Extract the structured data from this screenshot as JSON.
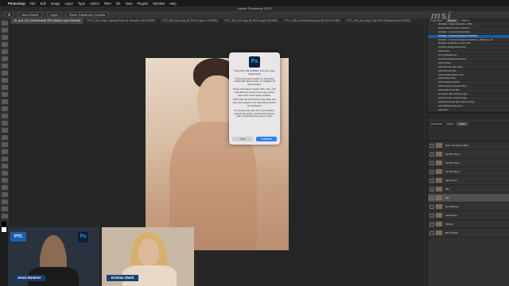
{
  "menubar": {
    "items": [
      "Photoshop",
      "File",
      "Edit",
      "Image",
      "Layer",
      "Type",
      "Select",
      "Filter",
      "3D",
      "View",
      "Plugins",
      "Window",
      "Help"
    ],
    "right": ""
  },
  "app_title": "Adobe Photoshop 2023",
  "options": {
    "auto_select": "Auto-Select:",
    "layer": "Layer",
    "transform": "Show Transform Controls"
  },
  "tabs": [
    {
      "label": "JS_and_KS_Reference@ 25% (Black Layer Mask/8)",
      "active": true
    },
    {
      "label": "PTC_DB_Pose_Spring Prom 04 Sample 108 RGB/8*",
      "active": false
    },
    {
      "label": "PTC_DB_full-copy @ 25% (Layer 4 RGB/8)",
      "active": false
    },
    {
      "label": "PTC_DB_full copy @ 25% (Layer RGB/8)",
      "active": false
    },
    {
      "label": "PTC_DB_in-sharpening.psd @ 25% RGB/8",
      "active": false
    },
    {
      "label": "PTC_DB_full copy 2 @ 25% (Background RGB/8)",
      "active": false
    }
  ],
  "dialog": {
    "logo": "Ps",
    "paragraphs": [
      "The action has finished, here are a few helpful hints",
      "You'll only need to paint on the group masks (the black ones), so collapse all layer groups.",
      "Press Command / Option (PC: Ctrl + Alt) and click any arrow next to any group layer icon in the layers window.",
      "Paint with the brush tool using white at a very low opacity in the retouching doesn't go overboard.",
      "To remove this note from your actions, expand the action, scroll to the bottom, and uncheck the box next to Stop."
    ],
    "stop_label": "Stop",
    "continue_label": "Continue"
  },
  "watermark": "msi",
  "panels": {
    "top_tabs": [
      "Properties",
      "Actions",
      "History"
    ],
    "action_rows": [
      {
        "label": "Workflow - Image preparation_MSM",
        "sel": false
      },
      {
        "label": "Instant Glow Fix Action Collection",
        "sel": false
      },
      {
        "label": "Workflow - Frequency Separation",
        "sel": false
      },
      {
        "label": "Workflow - Portrait Full Retouch Workflow",
        "sel": true
      },
      {
        "label": "Workflow - Portrait Full Retouch Workflow - MSM Note 16",
        "sel": false
      },
      {
        "label": "Workflow Dodge Burn Action Pack",
        "sel": false
      },
      {
        "label": "Workflow Spring Action Pack",
        "sel": false
      },
      {
        "label": "Healing Set",
        "sel": false
      },
      {
        "label": "Set Up Background",
        "sel": false
      },
      {
        "label": "New Box Background Effects",
        "sel": false
      },
      {
        "label": "Add Contrast",
        "sel": false
      },
      {
        "label": "Add Soft Glow Skin Blurry",
        "sel": false
      },
      {
        "label": "Add Soft Glow Blur",
        "sel": false
      },
      {
        "label": "Add Soft Blend Warm Light",
        "sel": false
      },
      {
        "label": "Add Gradient Map",
        "sel": false
      },
      {
        "label": "Add Sharpening Effect",
        "sel": false
      },
      {
        "label": "Add Frequency Separate Blur",
        "sel": false
      },
      {
        "label": "Add Dodge Brush Blur",
        "sel": false
      },
      {
        "label": "First Brush Blur Vertical Image",
        "sel": false
      },
      {
        "label": "Soft Brush Blur Vertical Image",
        "sel": false
      },
      {
        "label": "Add Brush Dodge Burn Vertical Image",
        "sel": false
      },
      {
        "label": "Add Highlight Dodge Burn",
        "sel": false
      },
      {
        "label": "Add Color",
        "sel": false
      },
      {
        "label": "Color Check",
        "sel": false
      },
      {
        "label": "Blur Check",
        "sel": false
      }
    ],
    "layer_tabs": [
      "Channels",
      "Paths",
      "Layers"
    ],
    "layer_rows": [
      {
        "label": "Dust / Scratches Map",
        "sel": false
      },
      {
        "label": "Sat 3D Map 1",
        "sel": false
      },
      {
        "label": "Sat 3D Map 2",
        "sel": false
      },
      {
        "label": "Sat 3D Map 3",
        "sel": false
      },
      {
        "label": "Skin Tones",
        "sel": false
      },
      {
        "label": "Blur",
        "sel": false
      },
      {
        "label": "Blur",
        "sel": true
      },
      {
        "label": "Eye Brighten",
        "sel": false
      },
      {
        "label": "Add Stroke",
        "sel": false
      },
      {
        "label": "Models",
        "sel": false
      },
      {
        "label": "Blend Mask",
        "sel": false
      },
      {
        "label": "Gaussian Blur",
        "sel": false
      }
    ]
  },
  "webcams": {
    "left_name": "Jesús Ramirez",
    "right_name": "Kristina Sherk",
    "ptc_logo": "PTC",
    "ps_logo": "Ps"
  }
}
